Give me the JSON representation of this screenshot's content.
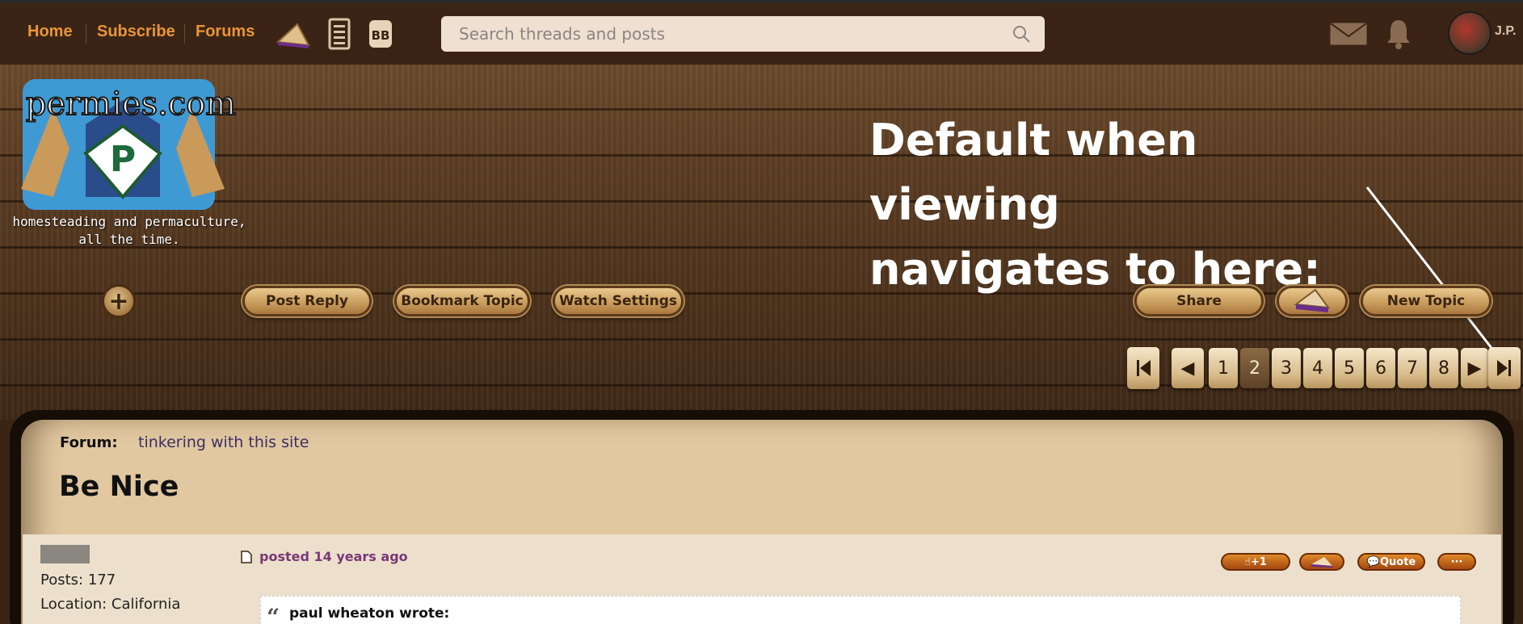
{
  "nav": {
    "home": "Home",
    "subscribe": "Subscribe",
    "forums": "Forums",
    "search_placeholder": "Search threads and posts",
    "bb_label": "BB",
    "user_initials": "J.P."
  },
  "logo": {
    "wordmark": "permies.com",
    "tagline_line1": "homesteading and permaculture,",
    "tagline_line2": "all the time."
  },
  "annotation": {
    "line1": "Default when viewing",
    "line2": "navigates to here:"
  },
  "toolbar": {
    "post_reply": "Post Reply",
    "bookmark_topic": "Bookmark Topic",
    "watch_settings": "Watch Settings",
    "share": "Share",
    "new_topic": "New Topic"
  },
  "pagination": {
    "pages": [
      "1",
      "2",
      "3",
      "4",
      "5",
      "6",
      "7",
      "8"
    ],
    "current": "2",
    "prev": "◀",
    "next": "▶"
  },
  "thread": {
    "forum_label": "Forum:",
    "forum_name": "tinkering with this site",
    "title": "Be Nice"
  },
  "post": {
    "posts_count": "Posts: 177",
    "location": "Location: California",
    "posted": "posted 14 years ago",
    "plus_one": "+1",
    "quote": "Quote",
    "more": "···",
    "quote_author": "paul wheaton wrote:"
  },
  "colors": {
    "nav_link": "#e9953a",
    "nav_bg": "#3a2315",
    "panel_bg": "#e1c8a0",
    "current_page": "#5e4227"
  }
}
